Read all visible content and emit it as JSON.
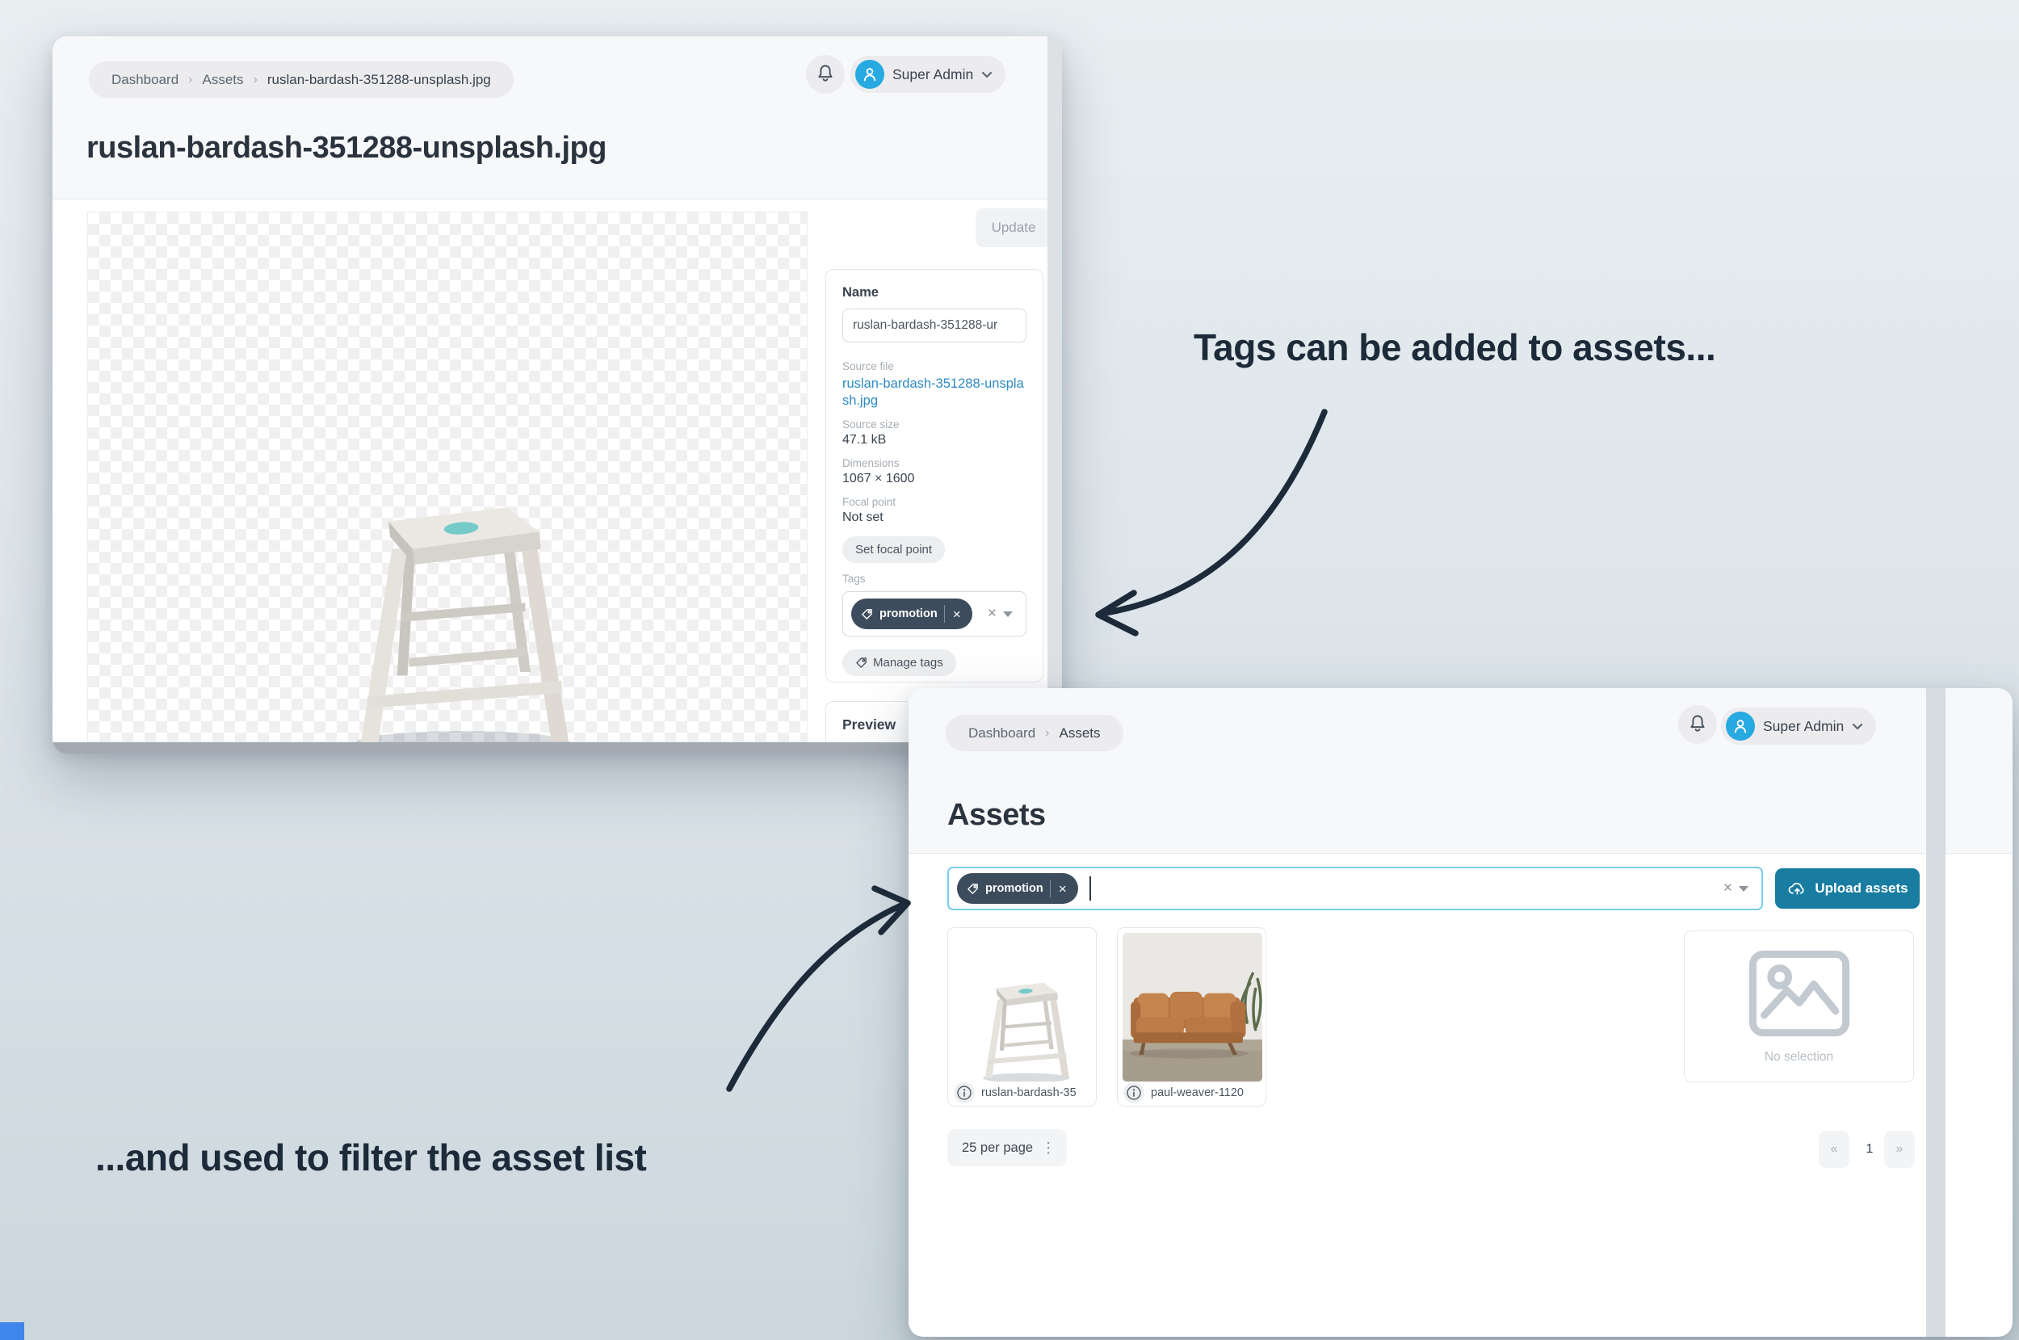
{
  "colors": {
    "accent_avatar": "#27a9e1",
    "link_blue": "#2d8cc3",
    "tag_pill_dark": "#3d4c5c",
    "upload_teal": "#197ca1",
    "filter_focus": "#79cdeb",
    "annotation_ink": "#1c2a39",
    "photo_blue": "#7fb2d8"
  },
  "icons": {
    "breadcrumb_separator": "›",
    "remove": "×",
    "kebab": "⋮"
  },
  "annotations": {
    "tags_note": "Tags can be added to assets...",
    "filter_note": "...and used to filter the asset list"
  },
  "detail_window": {
    "breadcrumb": {
      "items": [
        "Dashboard",
        "Assets",
        "ruslan-bardash-351288-unsplash.jpg"
      ]
    },
    "user_menu": {
      "name": "Super Admin"
    },
    "title": "ruslan-bardash-351288-unsplash.jpg",
    "update_button": "Update",
    "fields": {
      "name_label": "Name",
      "name_value": "ruslan-bardash-351288-ur",
      "source_file_label": "Source file",
      "source_file_value": "ruslan-bardash-351288-unsplash.jpg",
      "source_size_label": "Source size",
      "source_size_value": "47.1 kB",
      "dimensions_label": "Dimensions",
      "dimensions_value": "1067 × 1600",
      "focal_label": "Focal point",
      "focal_value": "Not set",
      "set_focal_button": "Set focal point",
      "tags_label": "Tags",
      "tag": "promotion",
      "manage_tags_button": "Manage tags"
    },
    "preview_label": "Preview"
  },
  "list_window": {
    "breadcrumb": {
      "items": [
        "Dashboard",
        "Assets"
      ]
    },
    "user_menu": {
      "name": "Super Admin"
    },
    "heading": "Assets",
    "filter": {
      "tag": "promotion"
    },
    "upload_button": "Upload assets",
    "assets": [
      {
        "filename": "ruslan-bardash-35"
      },
      {
        "filename": "paul-weaver-1120"
      }
    ],
    "no_selection_label": "No selection",
    "per_page_label": "25 per page",
    "pagination": {
      "prev": "«",
      "page": "1",
      "next": "»"
    }
  }
}
